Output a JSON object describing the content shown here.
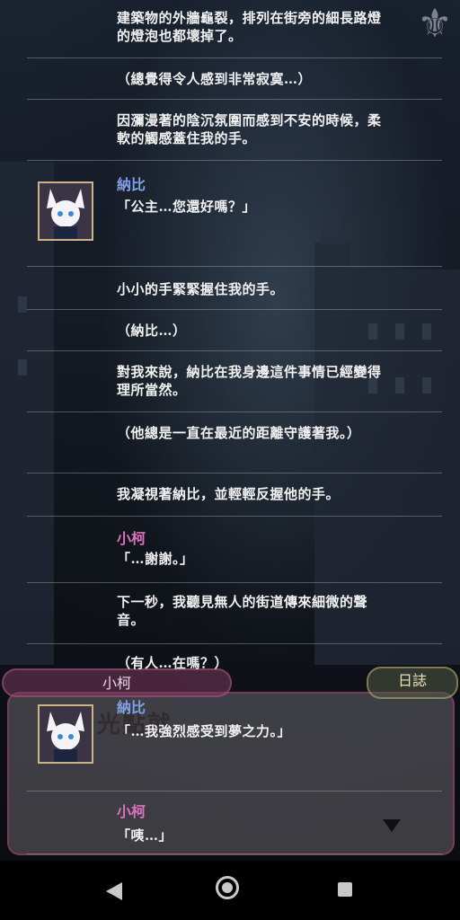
{
  "log_button_label": "日誌",
  "nameplate_name": "小柯",
  "dialog_ghost_text": "光點就",
  "entries": [
    {
      "type": "narration",
      "text": "建築物的外牆龜裂，排列在街旁的細長路燈的燈泡也都壞掉了。"
    },
    {
      "type": "narration",
      "text": "（總覺得令人感到非常寂寞…）"
    },
    {
      "type": "narration",
      "text": "因瀰漫著的陰沉氛圍而感到不安的時候，柔軟的觸感蓋住我的手。"
    },
    {
      "type": "dialogue",
      "speaker": "納比",
      "text": "「公主…您還好嗎？」"
    },
    {
      "type": "narration",
      "text": "小小的手緊緊握住我的手。"
    },
    {
      "type": "narration",
      "text": "（納比…）"
    },
    {
      "type": "narration",
      "text": "對我來說，納比在我身邊這件事情已經變得理所當然。"
    },
    {
      "type": "narration",
      "text": "（他總是一直在最近的距離守護著我。）"
    },
    {
      "type": "narration",
      "text": "我凝視著納比，並輕輕反握他的手。"
    },
    {
      "type": "dialogue",
      "speaker": "小柯",
      "text": "「…謝謝。」"
    },
    {
      "type": "narration",
      "text": "下一秒，我聽見無人的街道傳來細微的聲音。"
    },
    {
      "type": "narration",
      "text": "（有人…在嗎？）"
    },
    {
      "type": "dialogue",
      "speaker": "納比",
      "text": "「…我強烈感受到夢之力。」"
    },
    {
      "type": "dialogue",
      "speaker": "小柯",
      "text": "「咦…」"
    }
  ],
  "colors": {
    "speaker_napi": "#7fa0e8",
    "speaker_ko": "#e070c0",
    "text": "#f2f2f2"
  }
}
